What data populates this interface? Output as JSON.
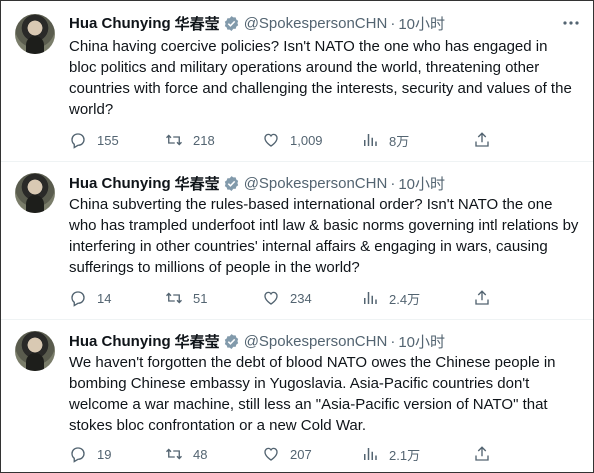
{
  "tweets": [
    {
      "author": {
        "name": "Hua Chunying",
        "name_cn": "华春莹",
        "handle": "@SpokespersonCHN",
        "time": "10小时"
      },
      "text": "China having coercive policies? Isn't NATO the one who has engaged in bloc politics and military operations around the world, threatening other countries with force and challenging the interests, security and values of the world?",
      "replies": "155",
      "retweets": "218",
      "likes": "1,009",
      "views": "8万"
    },
    {
      "author": {
        "name": "Hua Chunying",
        "name_cn": "华春莹",
        "handle": "@SpokespersonCHN",
        "time": "10小时"
      },
      "text": "China subverting the rules-based international order? Isn't NATO the one who has trampled underfoot intl law & basic norms governing intl relations by interfering in other countries' internal affairs & engaging in wars, causing sufferings to millions of people in the world?",
      "replies": "14",
      "retweets": "51",
      "likes": "234",
      "views": "2.4万"
    },
    {
      "author": {
        "name": "Hua Chunying",
        "name_cn": "华春莹",
        "handle": "@SpokespersonCHN",
        "time": "10小时"
      },
      "text": "We haven't forgotten the debt of blood NATO owes the Chinese people in bombing Chinese embassy in Yugoslavia. Asia-Pacific countries don't welcome a war machine, still less an \"Asia-Pacific version of NATO\" that stokes bloc confrontation or a new Cold War.",
      "replies": "19",
      "retweets": "48",
      "likes": "207",
      "views": "2.1万"
    }
  ],
  "colors": {
    "verified": "#829aab",
    "meta": "#536471",
    "text": "#0f1419"
  },
  "icons": {
    "reply": "reply-icon",
    "retweet": "retweet-icon",
    "like": "heart-icon",
    "views": "views-chart-icon",
    "share": "share-icon",
    "more": "more-icon",
    "verified": "verified-badge-icon"
  }
}
